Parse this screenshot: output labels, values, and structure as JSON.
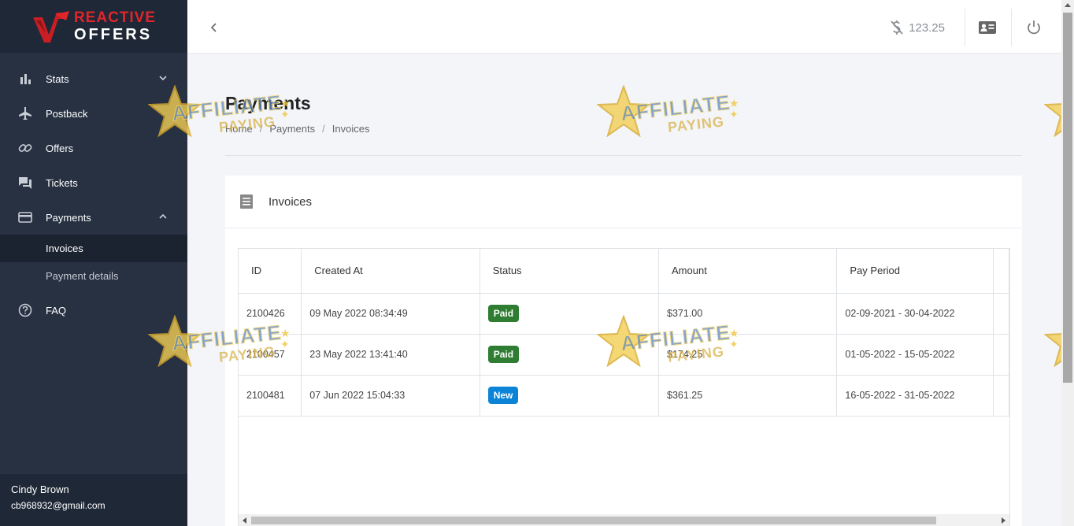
{
  "brand": {
    "line1": "REACTIVE",
    "line2": "OFFERS"
  },
  "sidebar": {
    "items": [
      {
        "label": "Stats",
        "icon": "bar-chart-icon",
        "expandable": true,
        "expanded": false
      },
      {
        "label": "Postback",
        "icon": "airplane-icon"
      },
      {
        "label": "Offers",
        "icon": "link-icon"
      },
      {
        "label": "Tickets",
        "icon": "chat-icon"
      },
      {
        "label": "Payments",
        "icon": "credit-card-icon",
        "expandable": true,
        "expanded": true
      },
      {
        "label": "FAQ",
        "icon": "help-circle-icon"
      }
    ],
    "payments_sub": [
      {
        "label": "Invoices",
        "active": true
      },
      {
        "label": "Payment details",
        "active": false
      }
    ],
    "user": {
      "name": "Cindy Brown",
      "email": "cb968932@gmail.com"
    }
  },
  "header": {
    "balance": "123.25"
  },
  "page": {
    "title": "Payments",
    "breadcrumb": [
      "Home",
      "Payments",
      "Invoices"
    ]
  },
  "card": {
    "title": "Invoices"
  },
  "table": {
    "headers": [
      "ID",
      "Created At",
      "Status",
      "Amount",
      "Pay Period"
    ],
    "rows": [
      {
        "id": "2100426",
        "created": "09 May 2022 08:34:49",
        "status": "Paid",
        "amount": "$371.00",
        "period": "02-09-2021 - 30-04-2022"
      },
      {
        "id": "2100457",
        "created": "23 May 2022 13:41:40",
        "status": "Paid",
        "amount": "$174.25",
        "period": "01-05-2022 - 15-05-2022"
      },
      {
        "id": "2100481",
        "created": "07 Jun 2022 15:04:33",
        "status": "New",
        "amount": "$361.25",
        "period": "16-05-2022 - 31-05-2022"
      }
    ]
  },
  "watermark": {
    "line1": "AFFILIATE",
    "line2": "PAYING"
  },
  "colors": {
    "sidebar_bg": "#273142",
    "badge_paid": "#2e7d32",
    "badge_new": "#0b84d8",
    "brand_red": "#e0262b"
  }
}
